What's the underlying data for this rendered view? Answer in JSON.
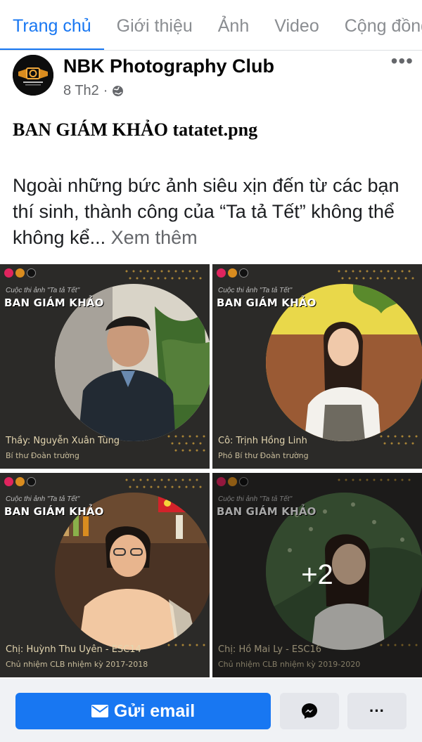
{
  "tabs": [
    {
      "label": "Trang chủ",
      "active": true
    },
    {
      "label": "Giới thiệu"
    },
    {
      "label": "Ảnh"
    },
    {
      "label": "Video"
    },
    {
      "label": "Cộng đồng"
    }
  ],
  "post": {
    "page_name": "NBK Photography Club",
    "date": "8 Th2",
    "separator": "·",
    "title": "BAN GIÁM KHẢO tatatet.png",
    "body": "Ngoài những bức ảnh siêu xịn đến từ các bạn thí sinh, thành công của “Ta tả Tết” không thể không kể...",
    "see_more": "Xem thêm"
  },
  "grid": {
    "contest_label": "Cuộc thi ảnh \"Ta tả Tết\"",
    "heading": "BAN GIÁM KHẢO",
    "images": [
      {
        "name": "Thầy: Nguyễn Xuân Tùng",
        "role": "Bí thư Đoàn trường"
      },
      {
        "name": "Cô: Trịnh Hồng Linh",
        "role": "Phó Bí thư Đoàn trường"
      },
      {
        "name": "Chị: Huỳnh Thu Uyên - ESC14",
        "role": "Chủ nhiệm CLB nhiệm kỳ 2017-2018"
      },
      {
        "name": "Chị: Hồ Mai Ly - ESC16",
        "role": "Chủ nhiệm CLB nhiệm kỳ 2019-2020",
        "more": "+2"
      }
    ]
  },
  "actions": {
    "email_label": "Gửi email",
    "messenger_icon": "messenger-icon",
    "more_label": "···"
  },
  "colors": {
    "accent": "#1877f2",
    "card_bg": "#2b2a28",
    "gold_dots": "#c79a3a"
  }
}
